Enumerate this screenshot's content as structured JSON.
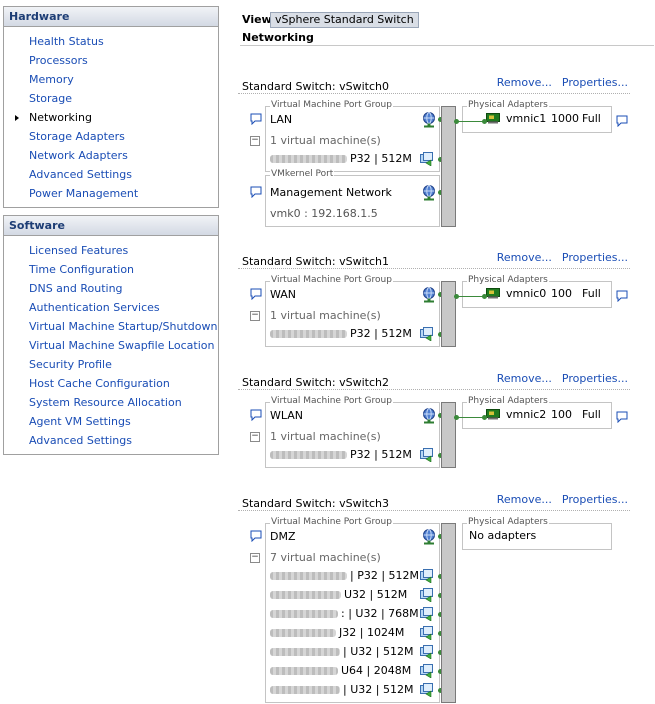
{
  "hardware": {
    "header": "Hardware",
    "items": [
      "Health Status",
      "Processors",
      "Memory",
      "Storage",
      "Networking",
      "Storage Adapters",
      "Network Adapters",
      "Advanced Settings",
      "Power Management"
    ],
    "active": "Networking"
  },
  "software": {
    "header": "Software",
    "items": [
      "Licensed Features",
      "Time Configuration",
      "DNS and Routing",
      "Authentication Services",
      "Virtual Machine Startup/Shutdown",
      "Virtual Machine Swapfile Location",
      "Security Profile",
      "Host Cache Configuration",
      "System Resource Allocation",
      "Agent VM Settings",
      "Advanced Settings"
    ]
  },
  "view": {
    "label": "View:",
    "value": "vSphere Standard Switch"
  },
  "page_title": "Networking",
  "labels": {
    "remove": "Remove...",
    "properties": "Properties...",
    "vm_port_group": "Virtual Machine Port Group",
    "vmkernel_port": "VMkernel Port",
    "physical_adapters": "Physical Adapters"
  },
  "colors": {
    "link": "#1a4db5",
    "header_text": "#1d3d75",
    "connector": "#3b8a3b"
  },
  "switches": [
    {
      "title": "Standard Switch: vSwitch0",
      "port_groups": [
        {
          "type": "vm",
          "name": "LAN",
          "count": "1 virtual machine(s)",
          "vms": [
            {
              "spec": "P32 | 512M"
            }
          ]
        },
        {
          "type": "vmkernel",
          "name": "Management Network",
          "ip": "vmk0 : 192.168.1.5"
        }
      ],
      "adapters": [
        {
          "name": "vmnic1",
          "speed": "1000",
          "duplex": "Full"
        }
      ]
    },
    {
      "title": "Standard Switch: vSwitch1",
      "port_groups": [
        {
          "type": "vm",
          "name": "WAN",
          "count": "1 virtual machine(s)",
          "vms": [
            {
              "spec": "P32 | 512M"
            }
          ]
        }
      ],
      "adapters": [
        {
          "name": "vmnic0",
          "speed": "100",
          "duplex": "Full"
        }
      ]
    },
    {
      "title": "Standard Switch: vSwitch2",
      "port_groups": [
        {
          "type": "vm",
          "name": "WLAN",
          "count": "1 virtual machine(s)",
          "vms": [
            {
              "spec": "P32 | 512M"
            }
          ]
        }
      ],
      "adapters": [
        {
          "name": "vmnic2",
          "speed": "100",
          "duplex": "Full"
        }
      ]
    },
    {
      "title": "Standard Switch: vSwitch3",
      "port_groups": [
        {
          "type": "vm",
          "name": "DMZ",
          "count": "7 virtual machine(s)",
          "vms": [
            {
              "spec": "| P32 | 512M"
            },
            {
              "spec": "U32 | 512M"
            },
            {
              "spec": ": | U32 | 768M"
            },
            {
              "spec": "J32 | 1024M"
            },
            {
              "spec": "| U32 | 512M"
            },
            {
              "spec": "U64 | 2048M"
            },
            {
              "spec": "| U32 | 512M"
            }
          ]
        }
      ],
      "adapters": [],
      "no_adapters_text": "No adapters"
    }
  ]
}
